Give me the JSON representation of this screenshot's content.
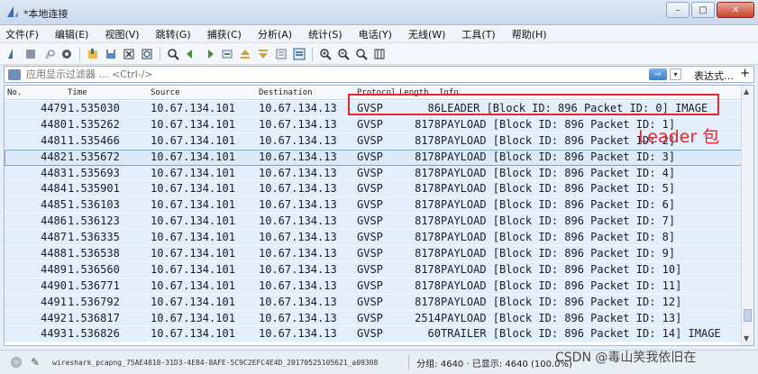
{
  "window": {
    "title": "*本地连接",
    "min": "–",
    "max": "□",
    "close": "✕"
  },
  "menu": [
    "文件(F)",
    "编辑(E)",
    "视图(V)",
    "跳转(G)",
    "捕获(C)",
    "分析(A)",
    "统计(S)",
    "电话(Y)",
    "无线(W)",
    "工具(T)",
    "帮助(H)"
  ],
  "filter": {
    "placeholder": "应用显示过滤器 … <Ctrl-/>",
    "apply_label": "⇨",
    "dropdown_label": "▾",
    "expression_label": "表达式…",
    "add_label": "+"
  },
  "columns": {
    "no": "No.",
    "time": "Time",
    "source": "Source",
    "destination": "Destination",
    "protocol": "Protocol",
    "length": "Length",
    "info": "Info"
  },
  "packets": [
    {
      "no": "4479",
      "time": "1.535030",
      "source": "10.67.134.101",
      "destination": "10.67.134.13",
      "protocol": "GVSP",
      "length": "86",
      "info": "LEADER [Block ID: 896 Packet ID: 0] IMAGE"
    },
    {
      "no": "4480",
      "time": "1.535262",
      "source": "10.67.134.101",
      "destination": "10.67.134.13",
      "protocol": "GVSP",
      "length": "8178",
      "info": "PAYLOAD [Block ID: 896 Packet ID: 1]"
    },
    {
      "no": "4481",
      "time": "1.535466",
      "source": "10.67.134.101",
      "destination": "10.67.134.13",
      "protocol": "GVSP",
      "length": "8178",
      "info": "PAYLOAD [Block ID: 896 Packet ID: 2]"
    },
    {
      "no": "4482",
      "time": "1.535672",
      "source": "10.67.134.101",
      "destination": "10.67.134.13",
      "protocol": "GVSP",
      "length": "8178",
      "info": "PAYLOAD [Block ID: 896 Packet ID: 3]"
    },
    {
      "no": "4483",
      "time": "1.535693",
      "source": "10.67.134.101",
      "destination": "10.67.134.13",
      "protocol": "GVSP",
      "length": "8178",
      "info": "PAYLOAD [Block ID: 896 Packet ID: 4]"
    },
    {
      "no": "4484",
      "time": "1.535901",
      "source": "10.67.134.101",
      "destination": "10.67.134.13",
      "protocol": "GVSP",
      "length": "8178",
      "info": "PAYLOAD [Block ID: 896 Packet ID: 5]"
    },
    {
      "no": "4485",
      "time": "1.536103",
      "source": "10.67.134.101",
      "destination": "10.67.134.13",
      "protocol": "GVSP",
      "length": "8178",
      "info": "PAYLOAD [Block ID: 896 Packet ID: 6]"
    },
    {
      "no": "4486",
      "time": "1.536123",
      "source": "10.67.134.101",
      "destination": "10.67.134.13",
      "protocol": "GVSP",
      "length": "8178",
      "info": "PAYLOAD [Block ID: 896 Packet ID: 7]"
    },
    {
      "no": "4487",
      "time": "1.536335",
      "source": "10.67.134.101",
      "destination": "10.67.134.13",
      "protocol": "GVSP",
      "length": "8178",
      "info": "PAYLOAD [Block ID: 896 Packet ID: 8]"
    },
    {
      "no": "4488",
      "time": "1.536538",
      "source": "10.67.134.101",
      "destination": "10.67.134.13",
      "protocol": "GVSP",
      "length": "8178",
      "info": "PAYLOAD [Block ID: 896 Packet ID: 9]"
    },
    {
      "no": "4489",
      "time": "1.536560",
      "source": "10.67.134.101",
      "destination": "10.67.134.13",
      "protocol": "GVSP",
      "length": "8178",
      "info": "PAYLOAD [Block ID: 896 Packet ID: 10]"
    },
    {
      "no": "4490",
      "time": "1.536771",
      "source": "10.67.134.101",
      "destination": "10.67.134.13",
      "protocol": "GVSP",
      "length": "8178",
      "info": "PAYLOAD [Block ID: 896 Packet ID: 11]"
    },
    {
      "no": "4491",
      "time": "1.536792",
      "source": "10.67.134.101",
      "destination": "10.67.134.13",
      "protocol": "GVSP",
      "length": "8178",
      "info": "PAYLOAD [Block ID: 896 Packet ID: 12]"
    },
    {
      "no": "4492",
      "time": "1.536817",
      "source": "10.67.134.101",
      "destination": "10.67.134.13",
      "protocol": "GVSP",
      "length": "2514",
      "info": "PAYLOAD [Block ID: 896 Packet ID: 13]"
    },
    {
      "no": "4493",
      "time": "1.536826",
      "source": "10.67.134.101",
      "destination": "10.67.134.13",
      "protocol": "GVSP",
      "length": "60",
      "info": "TRAILER [Block ID: 896 Packet ID: 14] IMAGE"
    }
  ],
  "annotation": {
    "label": "Leader 包",
    "color": "#e8262f"
  },
  "status": {
    "capture_file": "wireshark_pcapng_75AE4818-31D3-4E84-8AFE-5C9C2EFC4E4D_20170525105621_a09308",
    "packets_text": "分组: 4640 · 已显示: 4640 (100.0%)"
  },
  "watermark": "CSDN @毒山笑我依旧在",
  "colors": {
    "row_bg": "#e3eefb",
    "accent": "#e8262f"
  }
}
